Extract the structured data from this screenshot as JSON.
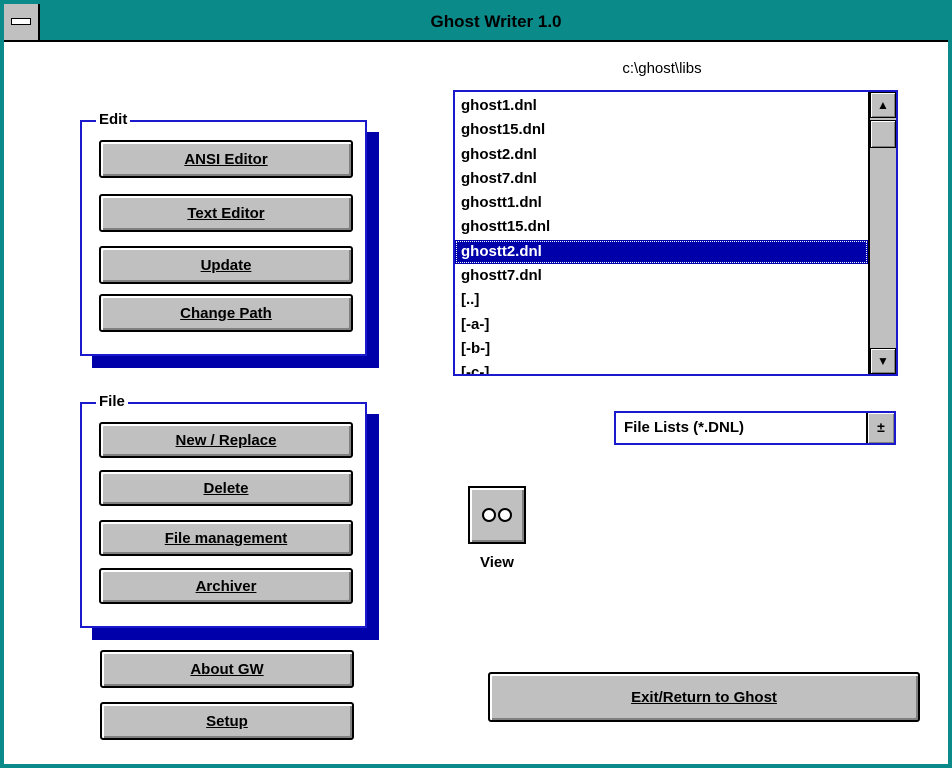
{
  "window": {
    "title": "Ghost Writer 1.0"
  },
  "edit_group": {
    "label": "Edit",
    "buttons": {
      "ansi_editor": "ANSI Editor",
      "text_editor": "Text Editor",
      "update": "Update",
      "change_path": "Change Path"
    }
  },
  "file_group": {
    "label": "File",
    "buttons": {
      "new_replace": "New / Replace",
      "delete": "Delete",
      "file_management": "File management",
      "archiver": "Archiver"
    }
  },
  "bottom_buttons": {
    "about": "About GW",
    "setup": "Setup",
    "exit": "Exit/Return to Ghost"
  },
  "directory": {
    "path": "c:\\ghost\\libs",
    "items": [
      "ghost1.dnl",
      "ghost15.dnl",
      "ghost2.dnl",
      "ghost7.dnl",
      "ghostt1.dnl",
      "ghostt15.dnl",
      "ghostt2.dnl",
      "ghostt7.dnl",
      "[..]",
      "[-a-]",
      "[-b-]",
      "[-c-]"
    ],
    "selected_index": 6
  },
  "file_type": {
    "selected": "File Lists (*.DNL)"
  },
  "view": {
    "label": "View"
  },
  "icons": {
    "scroll_up": "▲",
    "scroll_down": "▼",
    "combo_arrow": "±"
  },
  "colors": {
    "title_bar": "#0b8a8a",
    "selection": "#0000aa",
    "group_border": "#1a1acc"
  }
}
